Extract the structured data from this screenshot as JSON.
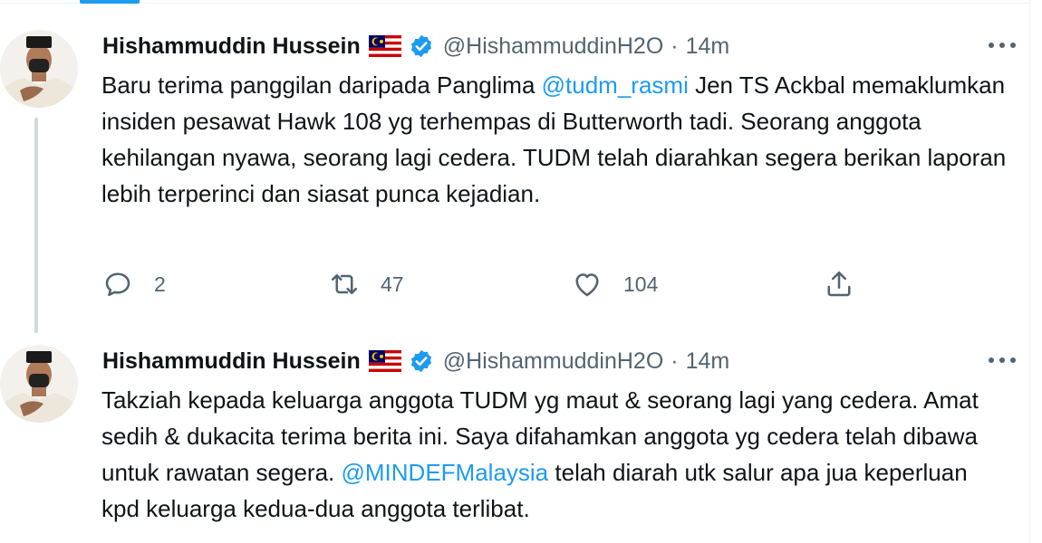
{
  "tweets": [
    {
      "author": {
        "name": "Hishammuddin Hussein",
        "flag_icon": "malaysia-flag-icon",
        "verified_icon": "verified-badge-icon",
        "handle": "@HishammuddinH2O"
      },
      "separator": "·",
      "time": "14m",
      "body": {
        "part1": "Baru terima panggilan daripada Panglima ",
        "mention": "@tudm_rasmi",
        "part2": " Jen TS Ackbal memaklumkan insiden pesawat Hawk 108 yg terhempas di Butterworth tadi. Seorang anggota kehilangan nyawa, seorang lagi cedera. TUDM telah diarahkan segera berikan laporan lebih terperinci dan siasat punca kejadian."
      },
      "actions": {
        "replies": "2",
        "retweets": "47",
        "likes": "104"
      }
    },
    {
      "author": {
        "name": "Hishammuddin Hussein",
        "flag_icon": "malaysia-flag-icon",
        "verified_icon": "verified-badge-icon",
        "handle": "@HishammuddinH2O"
      },
      "separator": "·",
      "time": "14m",
      "body": {
        "part1": "Takziah kepada keluarga anggota TUDM yg maut & seorang lagi yang cedera. Amat sedih & dukacita terima berita ini. Saya difahamkan anggota yg cedera telah dibawa untuk rawatan segera. ",
        "mention": "@MINDEFMalaysia",
        "part2": " telah diarah utk salur apa jua keperluan kpd keluarga kedua-dua anggota terlibat."
      }
    }
  ],
  "colors": {
    "accent": "#1d9bf0",
    "text": "#0f1419",
    "secondary": "#536471",
    "thread_line": "#cfd9de"
  }
}
